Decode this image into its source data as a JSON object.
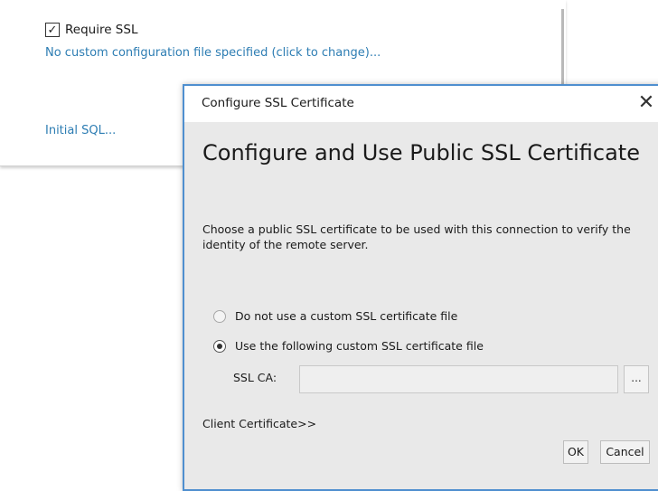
{
  "connection": {
    "require_ssl_label": "Require SSL",
    "require_ssl_checked": true,
    "config_link": "No custom configuration file specified (click to change)...",
    "initial_sql_link": "Initial SQL..."
  },
  "dialog": {
    "title": "Configure SSL Certificate",
    "close_glyph": "✕",
    "heading": "Configure and Use Public SSL Certificate",
    "description": "Choose a public SSL certificate to be used with this connection to verify the identity of the remote server.",
    "options": [
      {
        "label": "Do not use a custom SSL certificate file",
        "selected": false
      },
      {
        "label": "Use the following custom SSL certificate file",
        "selected": true
      }
    ],
    "ssl_ca_label": "SSL CA:",
    "ssl_ca_value": "",
    "browse_label": "...",
    "client_certificate": "Client Certificate>>",
    "ok_label": "OK",
    "cancel_label": "Cancel"
  },
  "colors": {
    "link": "#2d7db3",
    "dialog_border": "#4f8fcf",
    "dialog_bg": "#e9e9e9"
  }
}
